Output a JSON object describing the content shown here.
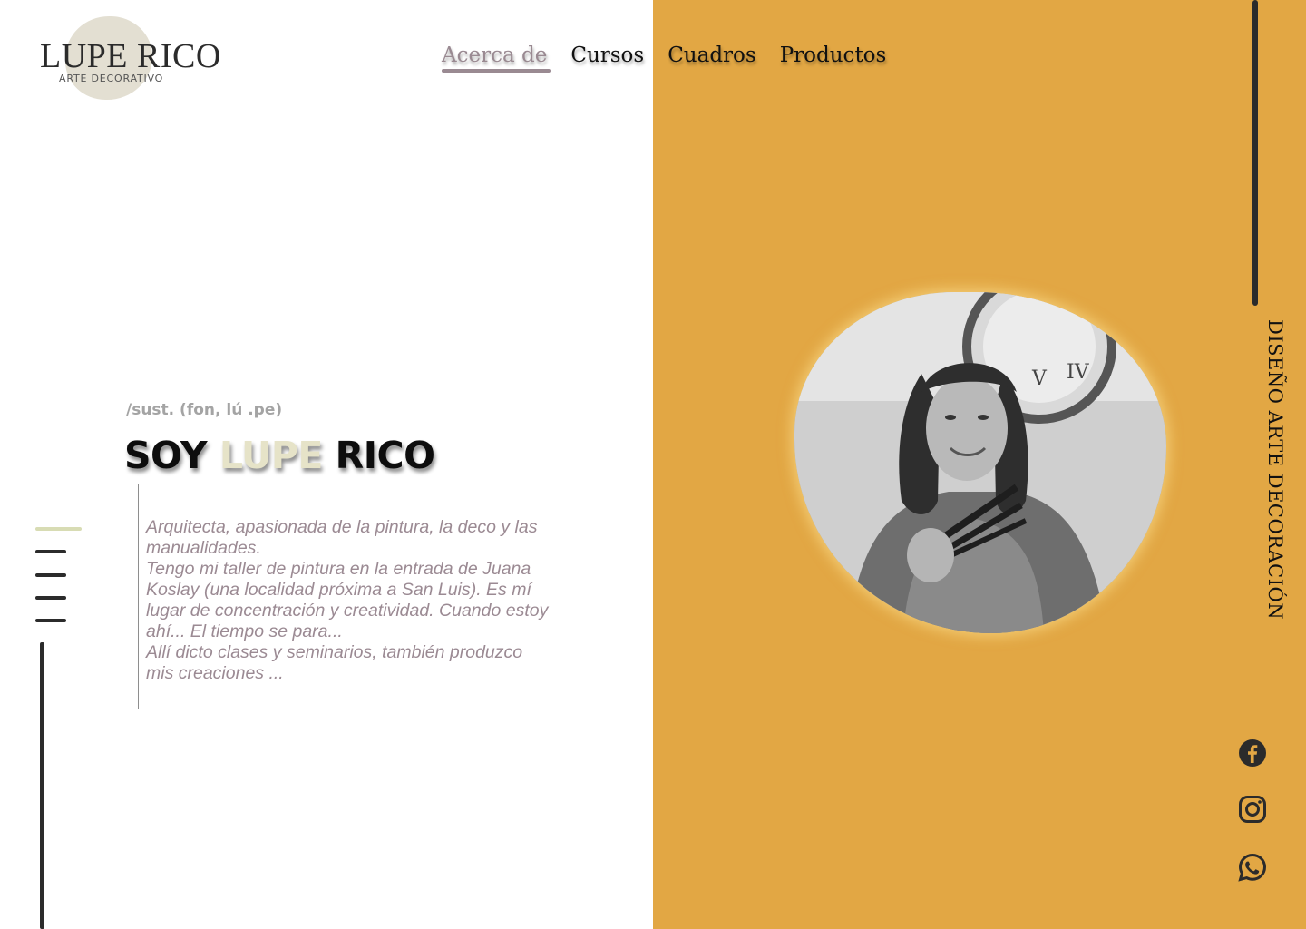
{
  "brand": {
    "name": "LUPE RICO",
    "tagline": "ARTE DECORATIVO"
  },
  "nav": {
    "items": [
      {
        "label": "Acerca de",
        "active": true
      },
      {
        "label": "Cursos",
        "active": false
      },
      {
        "label": "Cuadros",
        "active": false
      },
      {
        "label": "Productos",
        "active": false
      }
    ]
  },
  "hero": {
    "phonetic": "/sust. (fon, lú .pe)",
    "title_prefix": "SOY ",
    "title_highlight": "LUPE",
    "title_suffix": " RICO",
    "bio": [
      "Arquitecta, apasionada de la pintura, la deco y las manualidades.",
      "Tengo mi taller de pintura en la entrada de Juana Koslay (una localidad próxima a San Luis). Es mí lugar de concentración y creatividad. Cuando estoy ahí... El tiempo se para...",
      "Allí dicto clases y seminarios, también produzco mis creaciones ..."
    ]
  },
  "side": {
    "vertical_text": "DISEÑO ARTE DECORACIÓN"
  },
  "social": {
    "icons": [
      "facebook-icon",
      "instagram-icon",
      "whatsapp-icon"
    ]
  },
  "colors": {
    "accent_panel": "#e2a744",
    "highlight": "#e6e3c8",
    "nav_active": "#9a8a92",
    "bio_text": "#9b8a93",
    "dark": "#2b2b2b"
  }
}
